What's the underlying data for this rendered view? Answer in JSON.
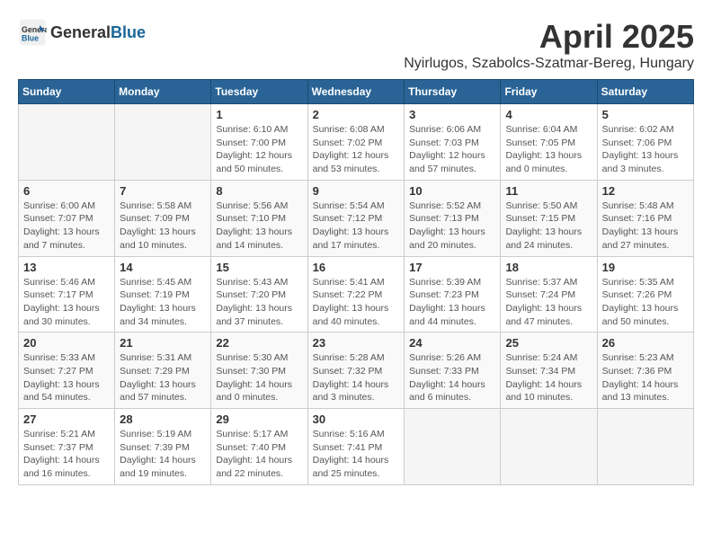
{
  "logo": {
    "text_general": "General",
    "text_blue": "Blue"
  },
  "header": {
    "month_year": "April 2025",
    "location": "Nyirlugos, Szabolcs-Szatmar-Bereg, Hungary"
  },
  "weekdays": [
    "Sunday",
    "Monday",
    "Tuesday",
    "Wednesday",
    "Thursday",
    "Friday",
    "Saturday"
  ],
  "weeks": [
    [
      {
        "day": "",
        "info": ""
      },
      {
        "day": "",
        "info": ""
      },
      {
        "day": "1",
        "info": "Sunrise: 6:10 AM\nSunset: 7:00 PM\nDaylight: 12 hours\nand 50 minutes."
      },
      {
        "day": "2",
        "info": "Sunrise: 6:08 AM\nSunset: 7:02 PM\nDaylight: 12 hours\nand 53 minutes."
      },
      {
        "day": "3",
        "info": "Sunrise: 6:06 AM\nSunset: 7:03 PM\nDaylight: 12 hours\nand 57 minutes."
      },
      {
        "day": "4",
        "info": "Sunrise: 6:04 AM\nSunset: 7:05 PM\nDaylight: 13 hours\nand 0 minutes."
      },
      {
        "day": "5",
        "info": "Sunrise: 6:02 AM\nSunset: 7:06 PM\nDaylight: 13 hours\nand 3 minutes."
      }
    ],
    [
      {
        "day": "6",
        "info": "Sunrise: 6:00 AM\nSunset: 7:07 PM\nDaylight: 13 hours\nand 7 minutes."
      },
      {
        "day": "7",
        "info": "Sunrise: 5:58 AM\nSunset: 7:09 PM\nDaylight: 13 hours\nand 10 minutes."
      },
      {
        "day": "8",
        "info": "Sunrise: 5:56 AM\nSunset: 7:10 PM\nDaylight: 13 hours\nand 14 minutes."
      },
      {
        "day": "9",
        "info": "Sunrise: 5:54 AM\nSunset: 7:12 PM\nDaylight: 13 hours\nand 17 minutes."
      },
      {
        "day": "10",
        "info": "Sunrise: 5:52 AM\nSunset: 7:13 PM\nDaylight: 13 hours\nand 20 minutes."
      },
      {
        "day": "11",
        "info": "Sunrise: 5:50 AM\nSunset: 7:15 PM\nDaylight: 13 hours\nand 24 minutes."
      },
      {
        "day": "12",
        "info": "Sunrise: 5:48 AM\nSunset: 7:16 PM\nDaylight: 13 hours\nand 27 minutes."
      }
    ],
    [
      {
        "day": "13",
        "info": "Sunrise: 5:46 AM\nSunset: 7:17 PM\nDaylight: 13 hours\nand 30 minutes."
      },
      {
        "day": "14",
        "info": "Sunrise: 5:45 AM\nSunset: 7:19 PM\nDaylight: 13 hours\nand 34 minutes."
      },
      {
        "day": "15",
        "info": "Sunrise: 5:43 AM\nSunset: 7:20 PM\nDaylight: 13 hours\nand 37 minutes."
      },
      {
        "day": "16",
        "info": "Sunrise: 5:41 AM\nSunset: 7:22 PM\nDaylight: 13 hours\nand 40 minutes."
      },
      {
        "day": "17",
        "info": "Sunrise: 5:39 AM\nSunset: 7:23 PM\nDaylight: 13 hours\nand 44 minutes."
      },
      {
        "day": "18",
        "info": "Sunrise: 5:37 AM\nSunset: 7:24 PM\nDaylight: 13 hours\nand 47 minutes."
      },
      {
        "day": "19",
        "info": "Sunrise: 5:35 AM\nSunset: 7:26 PM\nDaylight: 13 hours\nand 50 minutes."
      }
    ],
    [
      {
        "day": "20",
        "info": "Sunrise: 5:33 AM\nSunset: 7:27 PM\nDaylight: 13 hours\nand 54 minutes."
      },
      {
        "day": "21",
        "info": "Sunrise: 5:31 AM\nSunset: 7:29 PM\nDaylight: 13 hours\nand 57 minutes."
      },
      {
        "day": "22",
        "info": "Sunrise: 5:30 AM\nSunset: 7:30 PM\nDaylight: 14 hours\nand 0 minutes."
      },
      {
        "day": "23",
        "info": "Sunrise: 5:28 AM\nSunset: 7:32 PM\nDaylight: 14 hours\nand 3 minutes."
      },
      {
        "day": "24",
        "info": "Sunrise: 5:26 AM\nSunset: 7:33 PM\nDaylight: 14 hours\nand 6 minutes."
      },
      {
        "day": "25",
        "info": "Sunrise: 5:24 AM\nSunset: 7:34 PM\nDaylight: 14 hours\nand 10 minutes."
      },
      {
        "day": "26",
        "info": "Sunrise: 5:23 AM\nSunset: 7:36 PM\nDaylight: 14 hours\nand 13 minutes."
      }
    ],
    [
      {
        "day": "27",
        "info": "Sunrise: 5:21 AM\nSunset: 7:37 PM\nDaylight: 14 hours\nand 16 minutes."
      },
      {
        "day": "28",
        "info": "Sunrise: 5:19 AM\nSunset: 7:39 PM\nDaylight: 14 hours\nand 19 minutes."
      },
      {
        "day": "29",
        "info": "Sunrise: 5:17 AM\nSunset: 7:40 PM\nDaylight: 14 hours\nand 22 minutes."
      },
      {
        "day": "30",
        "info": "Sunrise: 5:16 AM\nSunset: 7:41 PM\nDaylight: 14 hours\nand 25 minutes."
      },
      {
        "day": "",
        "info": ""
      },
      {
        "day": "",
        "info": ""
      },
      {
        "day": "",
        "info": ""
      }
    ]
  ]
}
